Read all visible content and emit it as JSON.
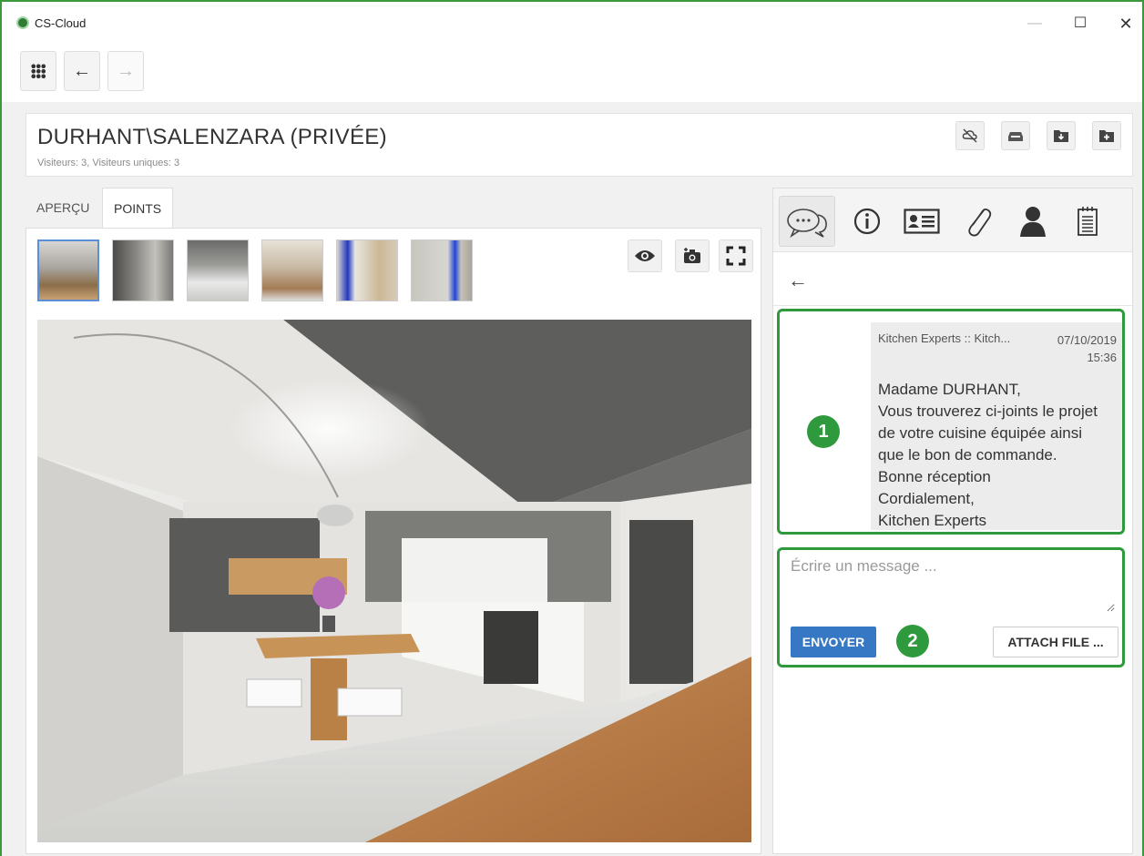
{
  "app": {
    "title": "CS-Cloud",
    "window_controls": {
      "minimize": "—",
      "maximize": "☐",
      "close": "✕"
    }
  },
  "toolbar": {
    "apps_icon": "apps-grid-icon",
    "back_icon": "←",
    "forward_icon": "→"
  },
  "header": {
    "title": "DURHANT\\SALENZARA (PRIVÉE)",
    "subtitle": "Visiteurs: 3, Visiteurs uniques: 3",
    "actions": [
      "cloud-off-icon",
      "inbox-icon",
      "download-folder-icon",
      "add-folder-icon"
    ]
  },
  "left_tabs": [
    {
      "label": "APERÇU",
      "active": false
    },
    {
      "label": "POINTS DE VUE",
      "active": true
    }
  ],
  "viewer": {
    "thumbnails": 6,
    "selected_thumbnail": 1,
    "buttons": [
      "eye-icon",
      "camera-add-icon",
      "fullscreen-icon"
    ]
  },
  "right_tabs": [
    "chat-icon",
    "info-icon",
    "contact-card-icon",
    "paperclip-icon",
    "user-icon",
    "notepad-icon"
  ],
  "message": {
    "sender": "Kitchen Experts :: Kitch...",
    "date": "07/10/2019",
    "time": "15:36",
    "lines": [
      "Madame DURHANT,",
      "Vous trouverez ci-joints le projet",
      "de votre cuisine équipée ainsi",
      "que le bon de commande.",
      "Bonne réception",
      "Cordialement,",
      "Kitchen Experts"
    ]
  },
  "compose": {
    "placeholder": "Écrire un message ...",
    "send_label": "ENVOYER",
    "attach_label": "ATTACH FILE ..."
  },
  "callouts": {
    "one": "1",
    "two": "2"
  },
  "colors": {
    "callout_green": "#2e9a3d",
    "send_blue": "#3678c3",
    "thumb_selected": "#5b8fd8"
  }
}
